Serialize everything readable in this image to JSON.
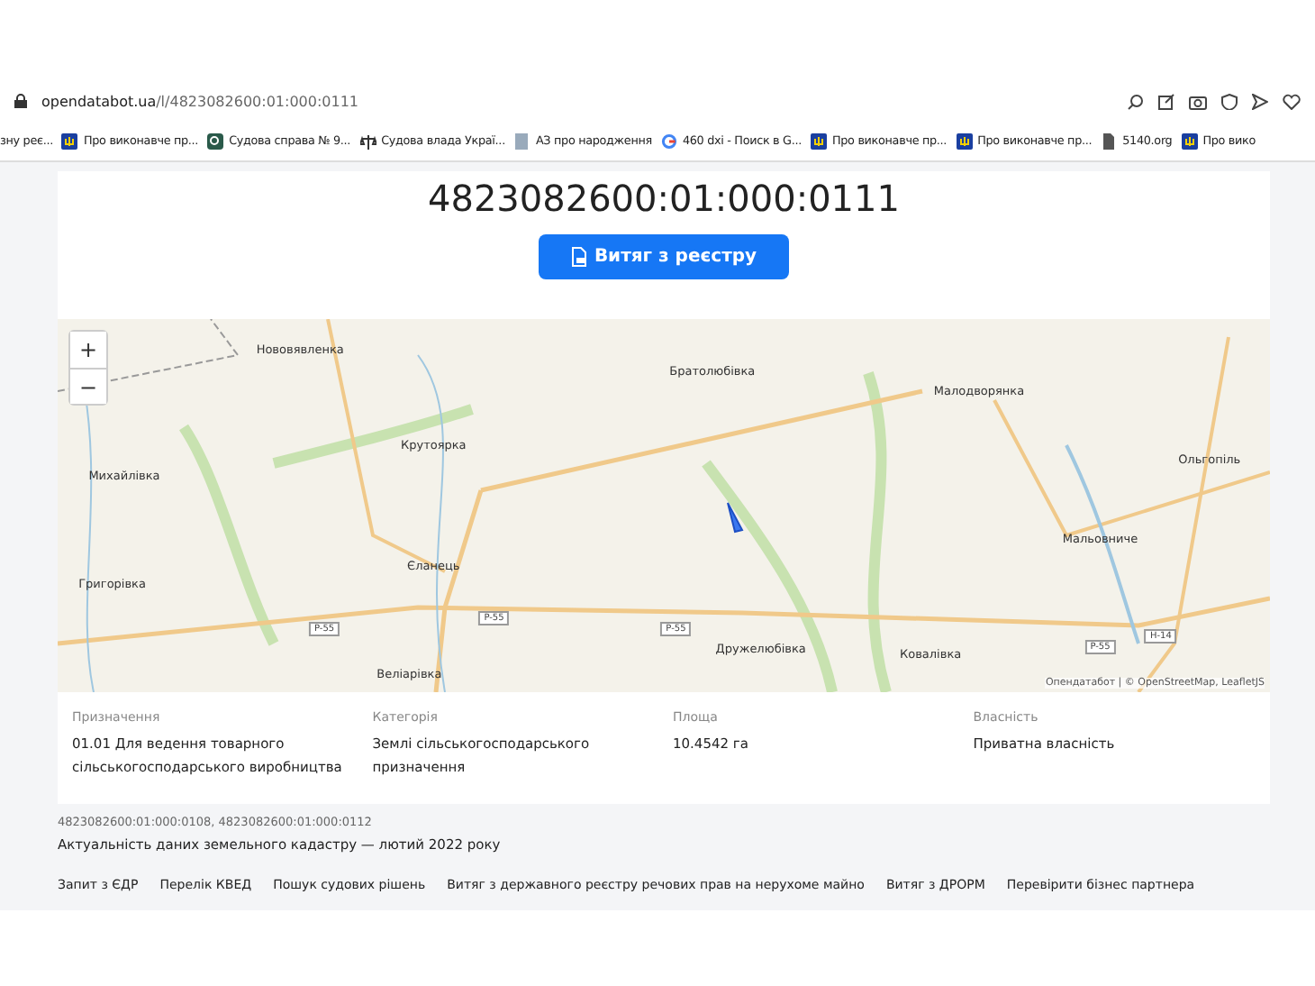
{
  "browser": {
    "url_host": "opendatabot.ua",
    "url_path": "/l/4823082600:01:000:0111",
    "bookmarks": [
      {
        "label": "зну реє...",
        "kind": "plain"
      },
      {
        "label": "Про виконавче пр...",
        "kind": "emblem"
      },
      {
        "label": "Судова справа № 9...",
        "kind": "search"
      },
      {
        "label": "Судова влада Украї...",
        "kind": "scales"
      },
      {
        "label": "АЗ про народження",
        "kind": "doc"
      },
      {
        "label": "460 dxi - Поиск в G...",
        "kind": "g"
      },
      {
        "label": "Про виконавче пр...",
        "kind": "emblem"
      },
      {
        "label": "Про виконавче пр...",
        "kind": "emblem"
      },
      {
        "label": "5140.org",
        "kind": "file"
      },
      {
        "label": "Про вико",
        "kind": "emblem"
      }
    ]
  },
  "parcel": {
    "cadastral_number": "4823082600:01:000:0111",
    "extract_button": "Витяг з реєстру"
  },
  "map": {
    "zoom_in": "+",
    "zoom_out": "−",
    "attribution": "Опендатабот | © OpenStreetMap, LeafletJS",
    "place_labels": [
      "Нововявленка",
      "Братолюбівка",
      "Малодворянка",
      "Крутоярка",
      "Михайлівка",
      "Ольгопіль",
      "Мальовниче",
      "Єланець",
      "Григорівка",
      "Дружелюбівка",
      "Ковалівка",
      "Веліарівка"
    ],
    "road_labels": [
      "P-55",
      "P-55",
      "P-55",
      "P-55",
      "H-14"
    ]
  },
  "details": [
    {
      "label": "Призначення",
      "value": "01.01 Для ведення товарного сільськогосподарського виробництва"
    },
    {
      "label": "Категорія",
      "value": "Землі сільськогосподарського призначення"
    },
    {
      "label": "Площа",
      "value": "10.4542 га"
    },
    {
      "label": "Власність",
      "value": "Приватна власність"
    }
  ],
  "neighbors": "4823082600:01:000:0108, 4823082600:01:000:0112",
  "actuality": "Актуальність даних земельного кадастру — лютий 2022 року",
  "links": [
    "Запит з ЄДР",
    "Перелік КВЕД",
    "Пошук судових рішень",
    "Витяг з державного реєстру речових прав на нерухоме майно",
    "Витяг з ДРОРМ",
    "Перевірити бізнес партнера"
  ]
}
